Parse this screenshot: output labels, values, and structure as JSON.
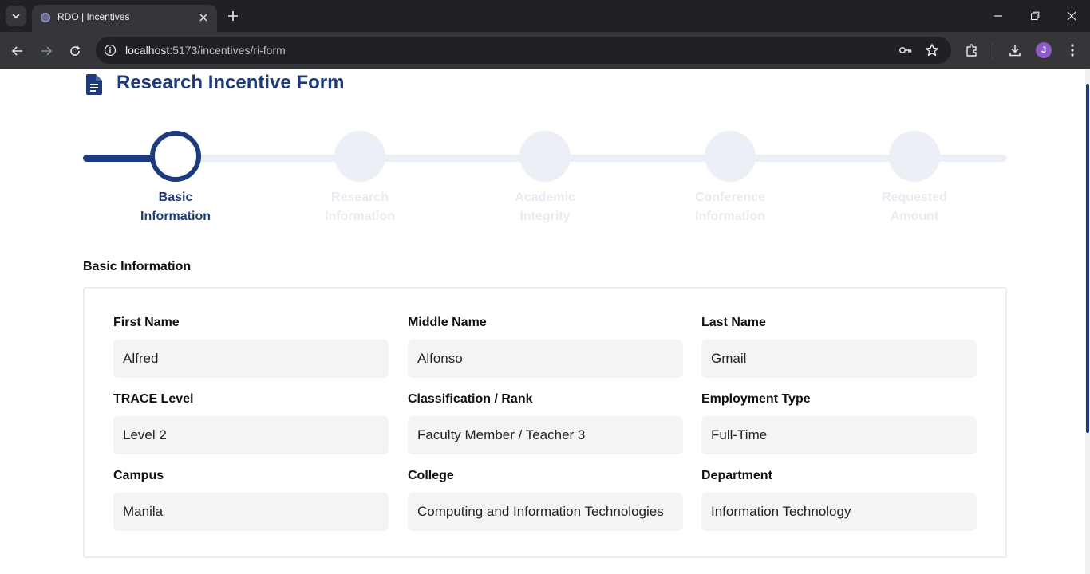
{
  "browser": {
    "tab_title": "RDO | Incentives",
    "url_host": "localhost",
    "url_path": ":5173/incentives/ri-form",
    "avatar_initial": "J"
  },
  "page": {
    "title": "Research Incentive Form",
    "accent_color": "#1c3a7c"
  },
  "stepper": {
    "steps": [
      {
        "label_line1": "Basic",
        "label_line2": "Information",
        "state": "active"
      },
      {
        "label_line1": "Research",
        "label_line2": "Information",
        "state": "inactive"
      },
      {
        "label_line1": "Academic",
        "label_line2": "Integrity",
        "state": "inactive"
      },
      {
        "label_line1": "Conference",
        "label_line2": "Information",
        "state": "inactive"
      },
      {
        "label_line1": "Requested",
        "label_line2": "Amount",
        "state": "inactive"
      }
    ]
  },
  "form": {
    "section_title": "Basic Information",
    "fields": {
      "first_name": {
        "label": "First Name",
        "value": "Alfred"
      },
      "middle_name": {
        "label": "Middle Name",
        "value": "Alfonso"
      },
      "last_name": {
        "label": "Last Name",
        "value": "Gmail"
      },
      "trace_level": {
        "label": "TRACE Level",
        "value": "Level 2"
      },
      "classification": {
        "label": "Classification / Rank",
        "value": "Faculty Member / Teacher 3"
      },
      "employment_type": {
        "label": "Employment Type",
        "value": "Full-Time"
      },
      "campus": {
        "label": "Campus",
        "value": "Manila"
      },
      "college": {
        "label": "College",
        "value": "Computing and Information Technologies"
      },
      "department": {
        "label": "Department",
        "value": "Information Technology"
      }
    }
  }
}
